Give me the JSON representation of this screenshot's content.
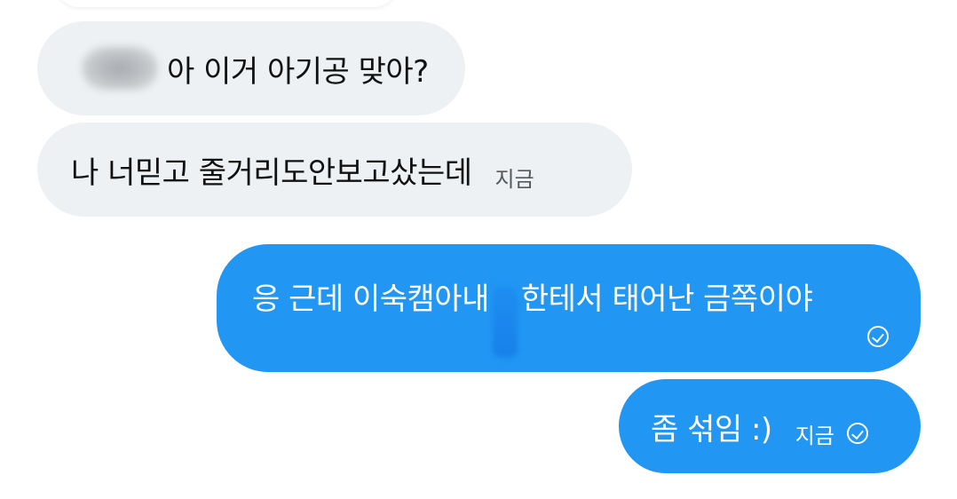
{
  "messages": [
    {
      "direction": "incoming",
      "text": "아 이거 아기공 맞아?",
      "time": ""
    },
    {
      "direction": "incoming",
      "text": "나 너믿고 줄거리도안보고샀는데",
      "time": "지금"
    },
    {
      "direction": "outgoing",
      "text_before": "응 근데 이숙캠아내",
      "text_after": "한테서 태어난 금쪽이야",
      "time": "",
      "status_icon": "sent-check-icon"
    },
    {
      "direction": "outgoing",
      "text": "좀 섞임 :)",
      "time": "지금",
      "status_icon": "sent-check-icon"
    }
  ],
  "colors": {
    "incoming_bubble": "#eef1f3",
    "outgoing_bubble": "#2196f3",
    "incoming_text": "#111111",
    "outgoing_text": "#ffffff"
  }
}
